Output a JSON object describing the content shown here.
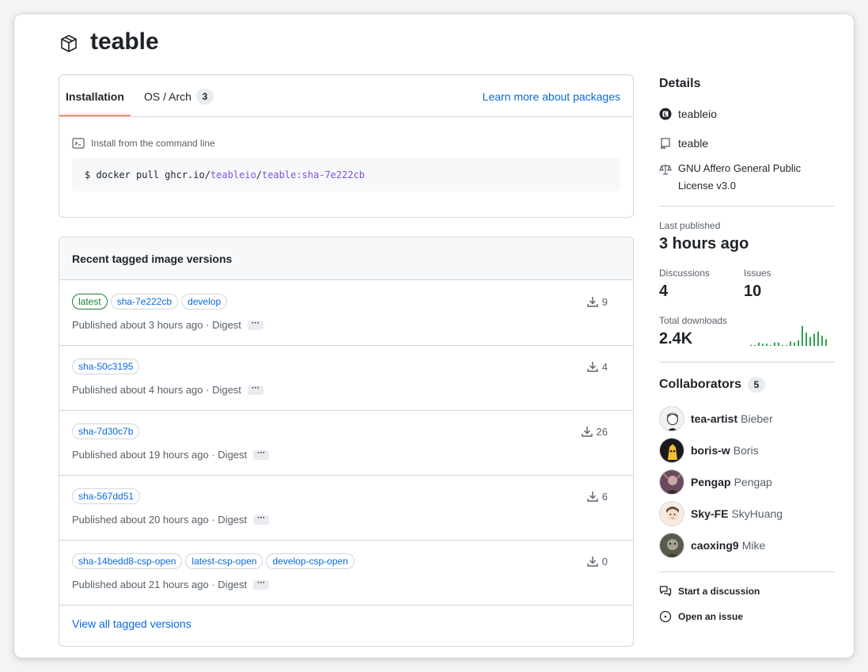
{
  "package": {
    "title": "teable",
    "icon": "package-icon"
  },
  "install": {
    "tabs": [
      {
        "label": "Installation"
      },
      {
        "label": "OS / Arch",
        "count": "3"
      }
    ],
    "learn_more": "Learn more about packages",
    "cmd_label": "Install from the command line",
    "cmd_prefix": "$ docker pull ghcr.io/",
    "cmd_owner": "teableio",
    "cmd_sep": "/",
    "cmd_image": "teable:sha-7e222cb"
  },
  "versions": {
    "header": "Recent tagged image versions",
    "rows": [
      {
        "tags": [
          "latest",
          "sha-7e222cb",
          "develop"
        ],
        "downloads": "9",
        "published": "Published about 3 hours ago · Digest",
        "dots": "···"
      },
      {
        "tags": [
          "sha-50c3195"
        ],
        "downloads": "4",
        "published": "Published about 4 hours ago · Digest",
        "dots": "···"
      },
      {
        "tags": [
          "sha-7d30c7b"
        ],
        "downloads": "26",
        "published": "Published about 19 hours ago · Digest",
        "dots": "···"
      },
      {
        "tags": [
          "sha-567dd51"
        ],
        "downloads": "6",
        "published": "Published about 20 hours ago · Digest",
        "dots": "···"
      },
      {
        "tags": [
          "sha-14bedd8-csp-open",
          "latest-csp-open",
          "develop-csp-open"
        ],
        "downloads": "0",
        "published": "Published about 21 hours ago · Digest",
        "dots": "···"
      }
    ],
    "view_all": "View all tagged versions"
  },
  "details": {
    "heading": "Details",
    "owner": "teableio",
    "repo": "teable",
    "license_line1": "GNU Affero General Public",
    "license_line2": "License v3.0",
    "last_published_label": "Last published",
    "last_published_value": "3 hours ago",
    "discussions_label": "Discussions",
    "discussions_value": "4",
    "issues_label": "Issues",
    "issues_value": "10",
    "total_downloads_label": "Total downloads",
    "total_downloads_value": "2.4K",
    "sparkline": [
      0.05,
      0,
      0.15,
      0.1,
      0.1,
      0,
      0.15,
      0.15,
      0,
      0,
      0.2,
      0.15,
      0.25,
      0.9,
      0.6,
      0.4,
      0.55,
      0.65,
      0.45,
      0.3
    ],
    "accent": "#2da44e"
  },
  "collaborators": {
    "heading": "Collaborators",
    "count": "5",
    "people": [
      {
        "login": "tea-artist",
        "name": "Bieber",
        "color": "#e8e8e8"
      },
      {
        "login": "boris-w",
        "name": "Boris",
        "color": "#1a1a1a"
      },
      {
        "login": "Pengap",
        "name": "Pengap",
        "color": "#6b4a5e"
      },
      {
        "login": "Sky-FE",
        "name": "SkyHuang",
        "color": "#e9ddd2"
      },
      {
        "login": "caoxing9",
        "name": "Mike",
        "color": "#5a5a4a"
      }
    ]
  },
  "actions": {
    "discussion": "Start a discussion",
    "issue": "Open an issue"
  }
}
